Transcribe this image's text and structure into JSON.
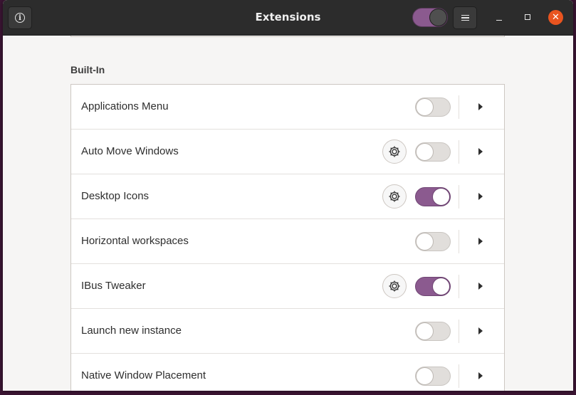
{
  "header": {
    "title": "Extensions",
    "global_switch": "on"
  },
  "section": {
    "title": "Built-In"
  },
  "extensions": [
    {
      "name": "Applications Menu",
      "has_settings": false,
      "enabled": false
    },
    {
      "name": "Auto Move Windows",
      "has_settings": true,
      "enabled": false
    },
    {
      "name": "Desktop Icons",
      "has_settings": true,
      "enabled": true
    },
    {
      "name": "Horizontal workspaces",
      "has_settings": false,
      "enabled": false
    },
    {
      "name": "IBus Tweaker",
      "has_settings": true,
      "enabled": true
    },
    {
      "name": "Launch new instance",
      "has_settings": false,
      "enabled": false
    },
    {
      "name": "Native Window Placement",
      "has_settings": false,
      "enabled": false
    }
  ],
  "colors": {
    "accent": "#8b5a8f",
    "close": "#e9541f",
    "headerbar": "#2c2c2c"
  }
}
